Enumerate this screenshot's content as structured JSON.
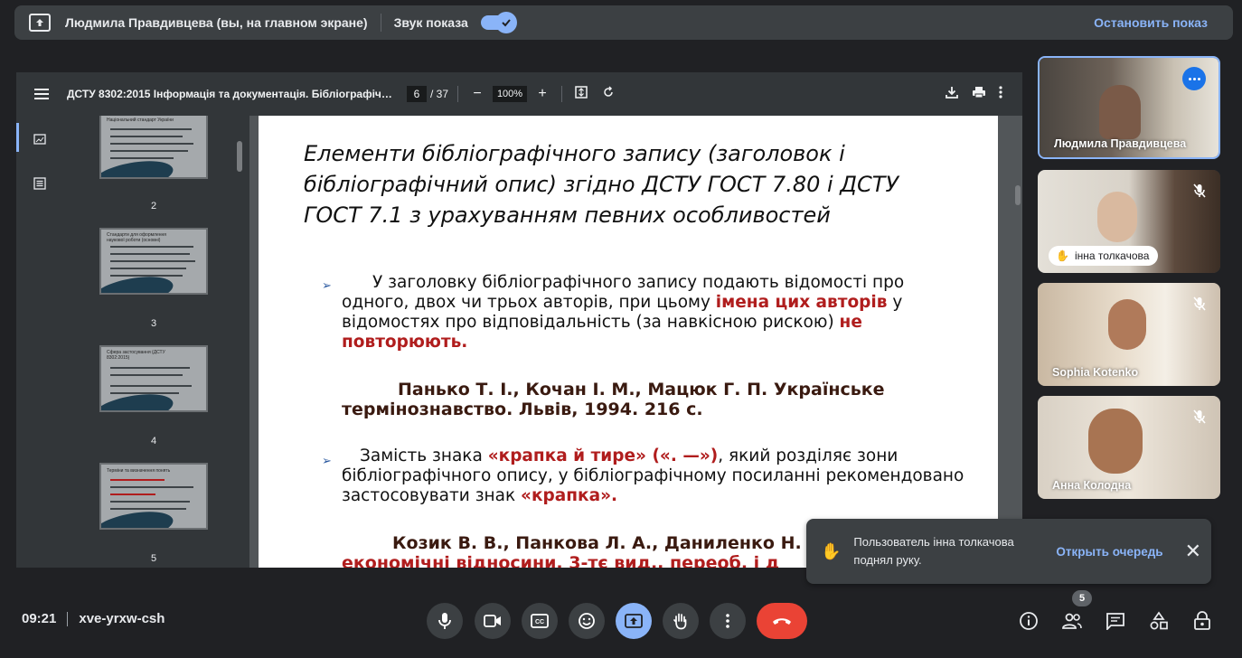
{
  "share_bar": {
    "presenter": "Людмила Правдивцева (вы, на главном экране)",
    "sound_label": "Звук показа",
    "sound_on": true,
    "stop_label": "Остановить показ"
  },
  "pdf": {
    "title": "ДСТУ 8302:2015 Інформація та документація. Бібліографічне п...",
    "page_current": "6",
    "page_total": "/ 37",
    "zoom": "100%",
    "thumbnails": [
      {
        "num": "2",
        "heading": "Національний стандарт України"
      },
      {
        "num": "3",
        "heading": "Стандарти для оформлення наукової роботи (основні)"
      },
      {
        "num": "4",
        "heading": "Сфера застосування (ДСТУ 8302:2015)"
      },
      {
        "num": "5",
        "heading": "Терміни та визначення понять"
      }
    ]
  },
  "slide": {
    "title": "Елементи бібліографічного запису (заголовок і бібліографічний опис) згідно ДСТУ ГОСТ 7.80 і ДСТУ ГОСТ 7.1 з урахуванням певних особливостей",
    "p1_part1": "У заголовку бібліографічного запису подають відомості про одного, двох чи трьох авторів, при цьому ",
    "p1_red1": "імена цих авторів",
    "p1_part2": " у відомостях про відповідальність (за навкісною рискою) ",
    "p1_red2": "не повторюють.",
    "example1": "Панько Т. І., Кочан І. М., Мацюк Г. П. Українське термінознавство. Львів, 1994. 216 с.",
    "p2_part1": "Замість знака ",
    "p2_red1": "«крапка й тире» («. —»)",
    "p2_part2": ", який розділяє зони бібліографічного опису, у бібліографічному посиланні рекомендовано застосовувати знак ",
    "p2_red2": "«крапка».",
    "example2_line1": "Козик В. В., Панкова Л. А., Даниленко Н.",
    "example2_line2": "економічні відносини. 3-тє вид., переоб. і д"
  },
  "participants": [
    {
      "name": "Людмила Правдивцева",
      "muted": false
    },
    {
      "name": "інна толкачова",
      "muted": true,
      "hand_raised": true
    },
    {
      "name": "Sophia Kotenko",
      "muted": true
    },
    {
      "name": "Анна Колодна",
      "muted": true
    }
  ],
  "notification": {
    "message": "Пользователь інна толкачова поднял руку.",
    "action": "Открыть очередь"
  },
  "bottom": {
    "time": "09:21",
    "meeting_code": "xve-yrxw-csh",
    "people_count": "5"
  },
  "colors": {
    "accent": "#8ab4f8",
    "end_call": "#ea4335",
    "slide_red": "#b01d1d"
  }
}
